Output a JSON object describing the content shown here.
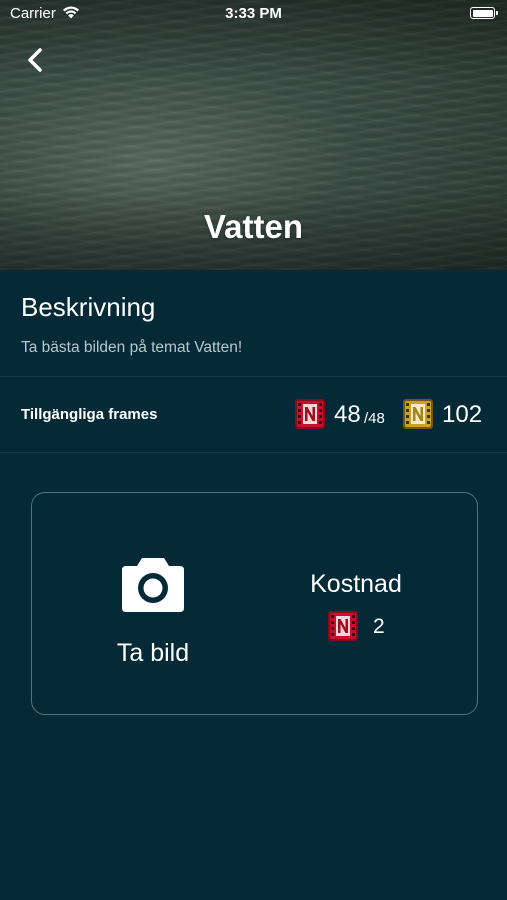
{
  "status_bar": {
    "carrier": "Carrier",
    "time": "3:33 PM"
  },
  "header": {
    "title": "Vatten",
    "back_icon": "chevron-left-icon"
  },
  "description": {
    "heading": "Beskrivning",
    "text": "Ta bästa bilden på temat Vatten!"
  },
  "frames": {
    "label": "Tillgängliga frames",
    "red_count": "48",
    "red_max": "/48",
    "gold_count": "102",
    "red_color": "#c8102e",
    "gold_color": "#c9a227"
  },
  "photo_card": {
    "action_label": "Ta bild",
    "camera_icon": "camera-icon",
    "cost_label": "Kostnad",
    "cost_value": "2"
  },
  "colors": {
    "background": "#042a38",
    "card_border": "#57707a",
    "secondary_text": "#b9c7cc"
  }
}
